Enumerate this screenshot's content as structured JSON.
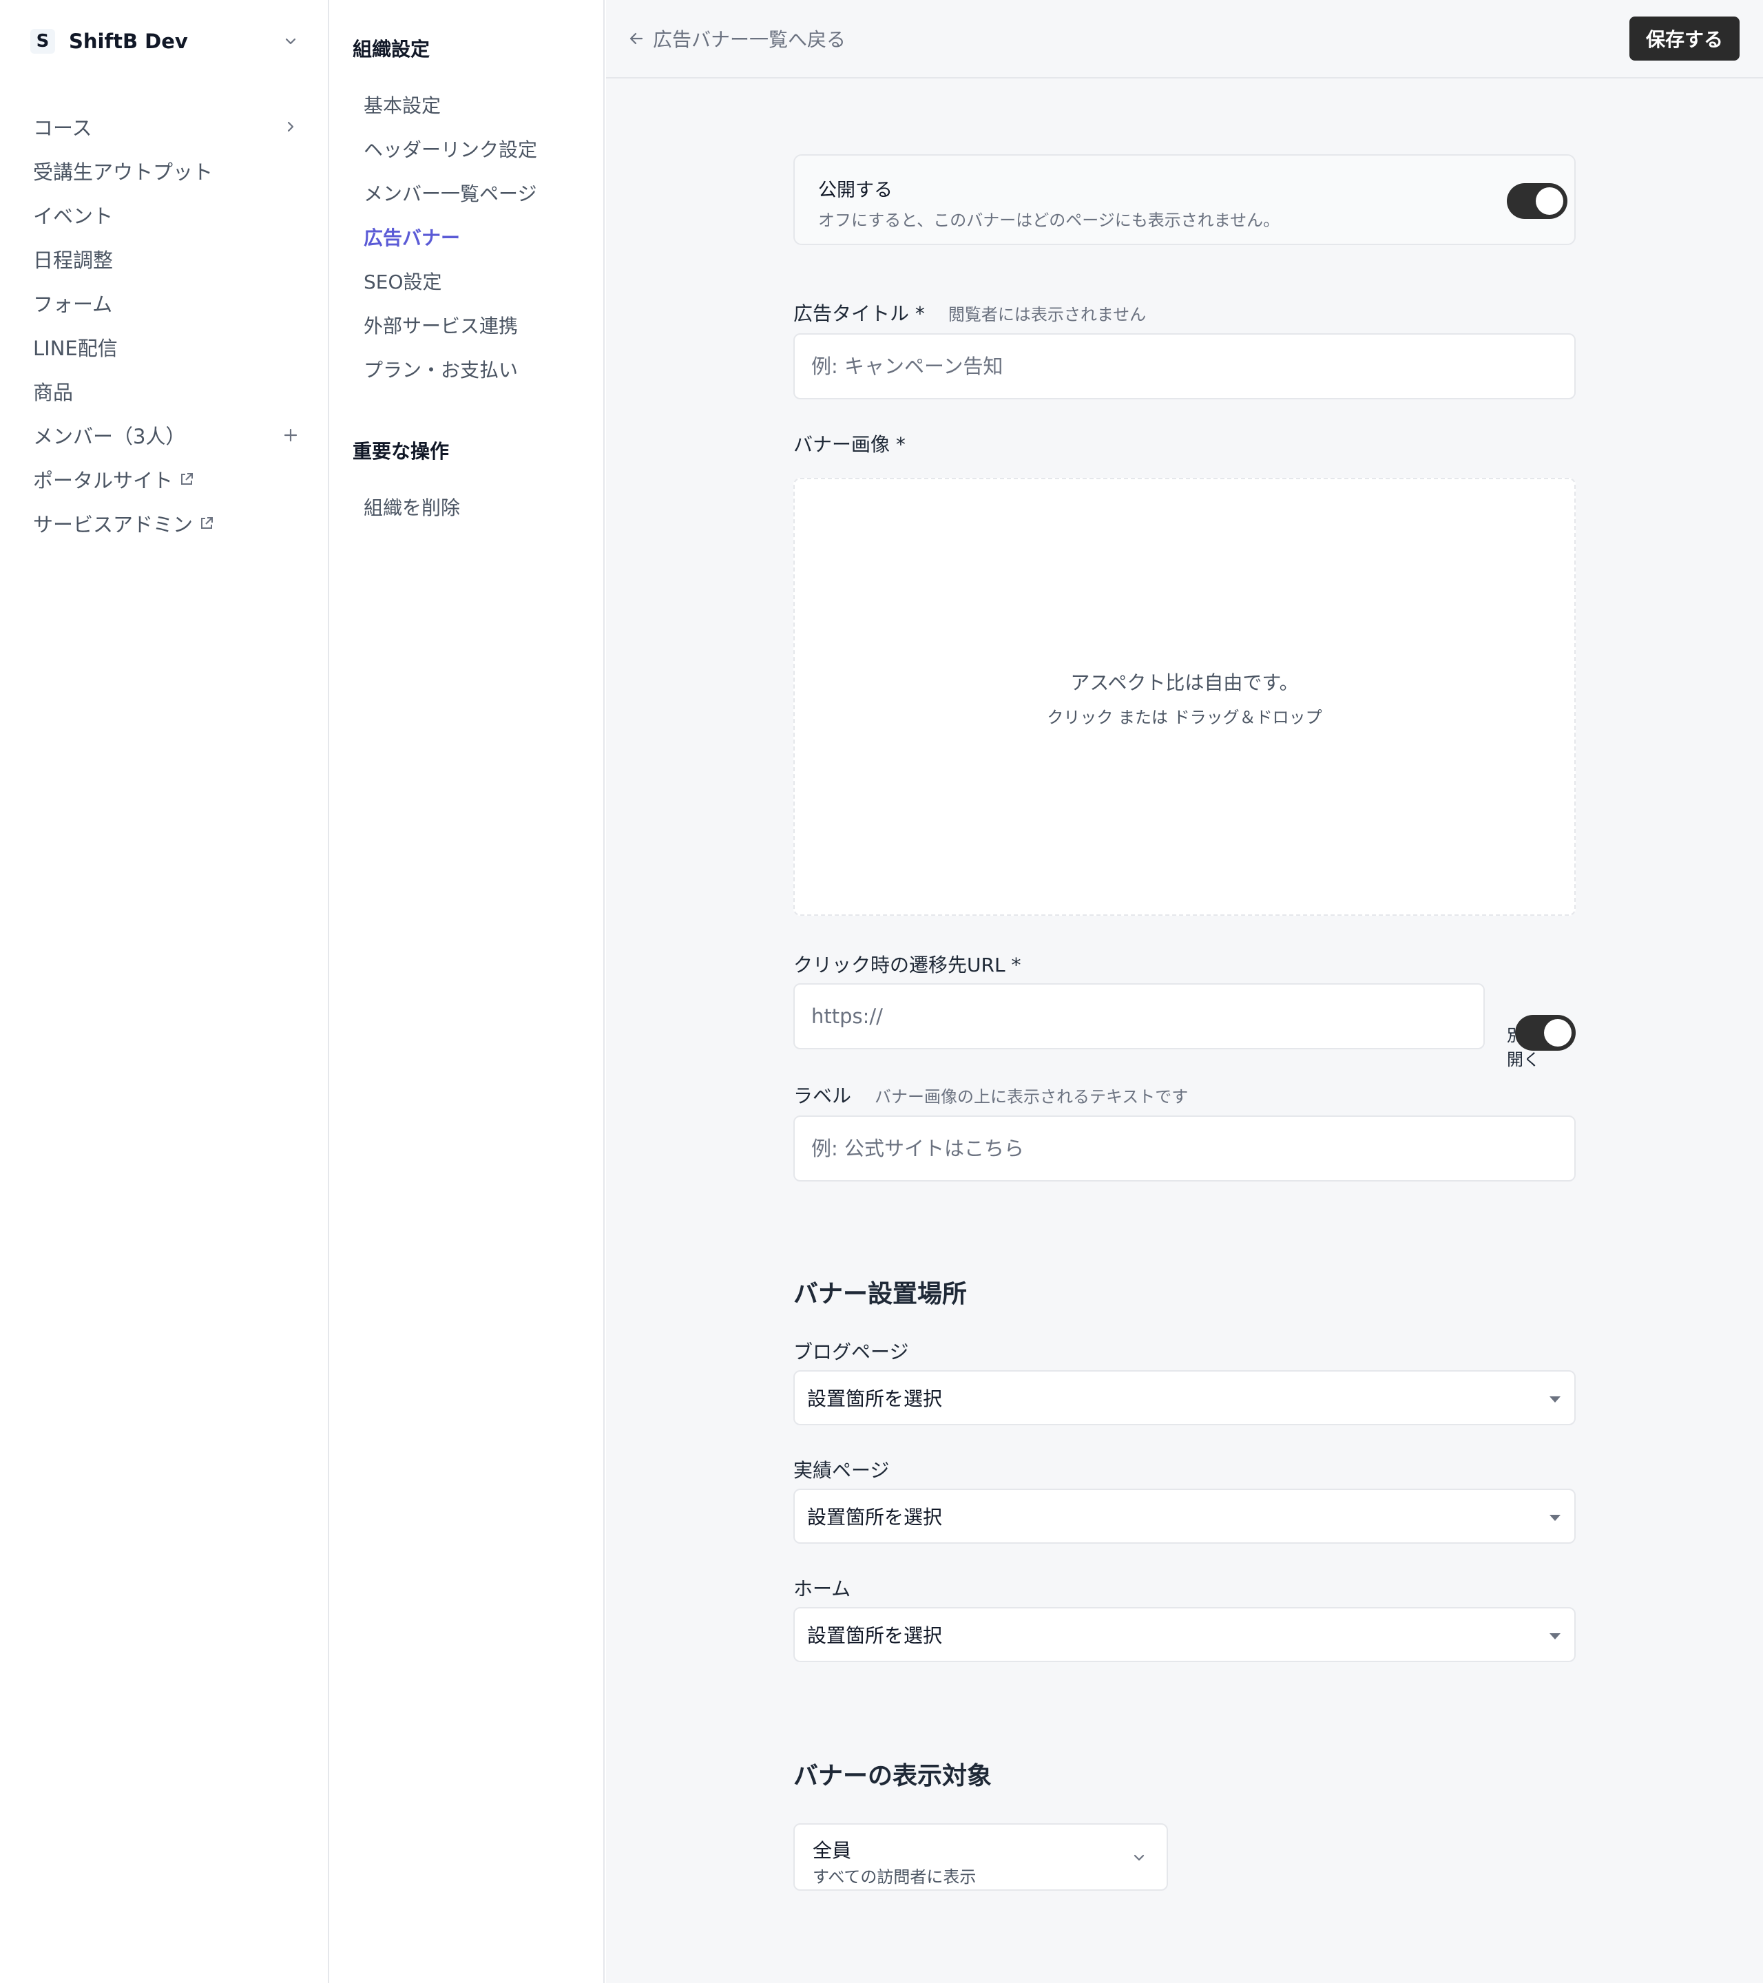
{
  "org": {
    "badge": "S",
    "name": "ShiftB Dev"
  },
  "sidebar": {
    "items": [
      {
        "label": "コース"
      },
      {
        "label": "受講生アウトプット"
      },
      {
        "label": "イベント"
      },
      {
        "label": "日程調整"
      },
      {
        "label": "フォーム"
      },
      {
        "label": "LINE配信"
      },
      {
        "label": "商品"
      },
      {
        "label": "メンバー（3人）"
      },
      {
        "label": "ポータルサイト"
      },
      {
        "label": "サービスアドミン"
      }
    ]
  },
  "submenu": {
    "heading": "組織設定",
    "items": [
      {
        "label": "基本設定"
      },
      {
        "label": "ヘッダーリンク設定"
      },
      {
        "label": "メンバー一覧ページ"
      },
      {
        "label": "広告バナー"
      },
      {
        "label": "SEO設定"
      },
      {
        "label": "外部サービス連携"
      },
      {
        "label": "プラン・お支払い"
      }
    ],
    "danger_heading": "重要な操作",
    "danger_items": [
      {
        "label": "組織を削除"
      }
    ]
  },
  "topbar": {
    "back_label": "広告バナー一覧へ戻る",
    "save_label": "保存する"
  },
  "form": {
    "publish": {
      "title": "公開する",
      "description": "オフにすると、このバナーはどのページにも表示されません。",
      "enabled": true
    },
    "title_field": {
      "label": "広告タイトル *",
      "hint": "閲覧者には表示されません",
      "placeholder": "例: キャンペーン告知",
      "value": ""
    },
    "image_field": {
      "label": "バナー画像 *",
      "dropzone_main": "アスペクト比は自由です。",
      "dropzone_sub": "クリック または ドラッグ＆ドロップ"
    },
    "url_field": {
      "label": "クリック時の遷移先URL *",
      "placeholder": "https://",
      "value": "",
      "new_tab_label": "別タブで開く",
      "new_tab_enabled": true
    },
    "label_field": {
      "label": "ラベル",
      "hint": "バナー画像の上に表示されるテキストです",
      "placeholder": "例: 公式サイトはこちら",
      "value": ""
    }
  },
  "placement": {
    "title": "バナー設置場所",
    "fields": [
      {
        "label": "ブログページ",
        "value": "設置箇所を選択"
      },
      {
        "label": "実績ページ",
        "value": "設置箇所を選択"
      },
      {
        "label": "ホーム",
        "value": "設置箇所を選択"
      }
    ]
  },
  "audience": {
    "title": "バナーの表示対象",
    "value": "全員",
    "description": "すべての訪問者に表示"
  },
  "colors": {
    "accent": "#5b5bd6",
    "button_dark": "#2b2b2b",
    "toggle_on": "#2f2f2f",
    "main_bg": "#f6f7f9"
  }
}
